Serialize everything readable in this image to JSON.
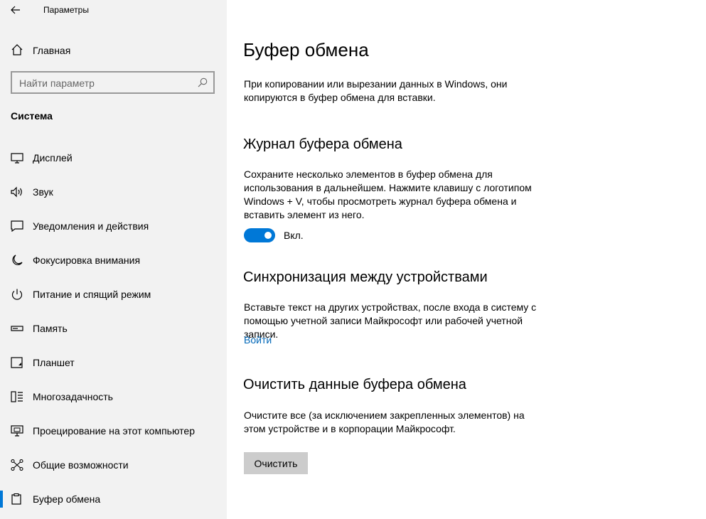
{
  "window": {
    "title": "Параметры"
  },
  "sidebar": {
    "home_label": "Главная",
    "search": {
      "placeholder": "Найти параметр"
    },
    "section": "Система",
    "items": [
      {
        "label": "Дисплей",
        "icon": "display-icon"
      },
      {
        "label": "Звук",
        "icon": "speaker-icon"
      },
      {
        "label": "Уведомления и действия",
        "icon": "notification-icon"
      },
      {
        "label": "Фокусировка внимания",
        "icon": "moon-icon"
      },
      {
        "label": "Питание и спящий режим",
        "icon": "power-icon"
      },
      {
        "label": "Память",
        "icon": "storage-icon"
      },
      {
        "label": "Планшет",
        "icon": "tablet-icon"
      },
      {
        "label": "Многозадачность",
        "icon": "multitasking-icon"
      },
      {
        "label": "Проецирование на этот компьютер",
        "icon": "projecting-icon"
      },
      {
        "label": "Общие возможности",
        "icon": "shared-experiences-icon"
      },
      {
        "label": "Буфер обмена",
        "icon": "clipboard-icon",
        "active": true
      }
    ]
  },
  "main": {
    "title": "Буфер обмена",
    "intro": "При копировании или вырезании данных в Windows, они копируются в буфер обмена для вставки.",
    "history": {
      "heading": "Журнал буфера обмена",
      "desc": "Сохраните несколько элементов в буфер обмена для использования в дальнейшем. Нажмите клавишу с логотипом Windows + V, чтобы просмотреть журнал буфера обмена и вставить элемент из него.",
      "toggle_state": "Вкл."
    },
    "sync": {
      "heading": "Синхронизация между устройствами",
      "desc": "Вставьте текст на других устройствах, после входа в систему с помощью учетной записи Майкрософт или рабочей учетной записи.",
      "link": "Войти"
    },
    "clear": {
      "heading": "Очистить данные буфера обмена",
      "desc": "Очистите все (за исключением закрепленных элементов) на этом устройстве и в корпорации Майкрософт.",
      "button": "Очистить"
    }
  },
  "colors": {
    "accent": "#0078d7",
    "link": "#0067b8",
    "sidebar_bg": "#f2f2f2",
    "button_bg": "#cccccc"
  }
}
